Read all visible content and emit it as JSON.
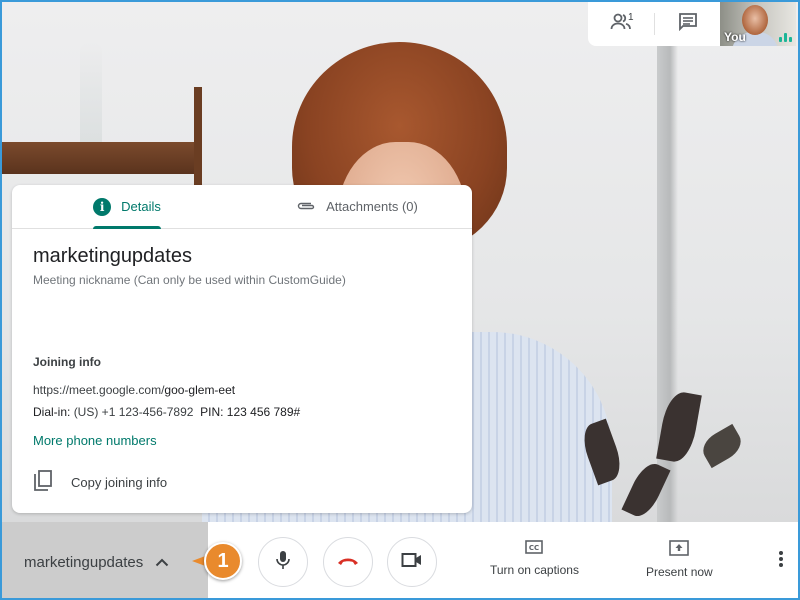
{
  "video": {
    "self_label": "You"
  },
  "top_controls": {
    "participants_count": "1",
    "participants_icon": "people-icon",
    "chat_icon": "chat-icon"
  },
  "details_panel": {
    "tabs": [
      {
        "label": "Details",
        "icon": "info-icon",
        "active": true
      },
      {
        "label": "Attachments (0)",
        "icon": "paperclip-icon",
        "active": false
      }
    ],
    "meeting_title": "marketingupdates",
    "meeting_subtitle": "Meeting nickname (Can only be used within CustomGuide)",
    "joining_heading": "Joining info",
    "join_url_prefix": "https://meet.google.com/",
    "join_url_code": "goo-glem-eet",
    "dial_label": "Dial-in:",
    "dial_number": "(US) +1 123-456-7892",
    "pin_label": "PIN:",
    "pin_value": "123 456 789#",
    "more_numbers_link": "More phone numbers",
    "copy_label": "Copy joining info"
  },
  "bottom_bar": {
    "meeting_name": "marketingupdates",
    "captions_label": "Turn on captions",
    "present_label": "Present now"
  },
  "callout": {
    "step": "1",
    "color": "#e98a2d"
  },
  "colors": {
    "accent": "#00796b",
    "hangup": "#d93025",
    "frame_border": "#3a9ad9"
  }
}
